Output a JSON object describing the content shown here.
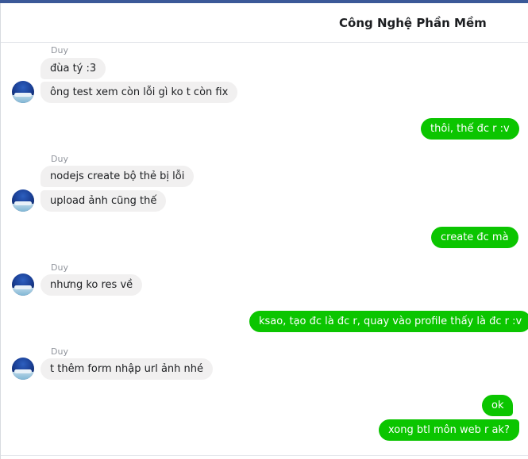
{
  "colors": {
    "top_bar": "#3b5998",
    "incoming_bubble": "#f1f0f0",
    "outgoing_bubble": "#0bc500",
    "sender_name": "#90949c"
  },
  "header": {
    "title": "Công Nghệ Phần Mềm"
  },
  "messages": [
    {
      "sender": "Duy",
      "direction": "incoming",
      "text": "đùa tý :3"
    },
    {
      "direction": "incoming",
      "text": "ông test xem còn lỗi gì ko t còn fix"
    },
    {
      "direction": "outgoing",
      "text": "thôi, thế đc r :v"
    },
    {
      "sender": "Duy",
      "direction": "incoming",
      "text": "nodejs create bộ thẻ bị lỗi"
    },
    {
      "direction": "incoming",
      "text": "upload ảnh cũng thế"
    },
    {
      "direction": "outgoing",
      "text": "create đc mà"
    },
    {
      "sender": "Duy",
      "direction": "incoming",
      "text": "nhưng ko res về"
    },
    {
      "direction": "outgoing",
      "text": "ksao, tạo đc là đc r, quay vào profile thấy là đc r :v"
    },
    {
      "sender": "Duy",
      "direction": "incoming",
      "text": "t thêm form nhập url ảnh nhé"
    },
    {
      "direction": "outgoing",
      "text": "ok"
    },
    {
      "direction": "outgoing",
      "text": "xong btl môn web r ak?"
    }
  ],
  "avatar_icon": "user-avatar-icon"
}
